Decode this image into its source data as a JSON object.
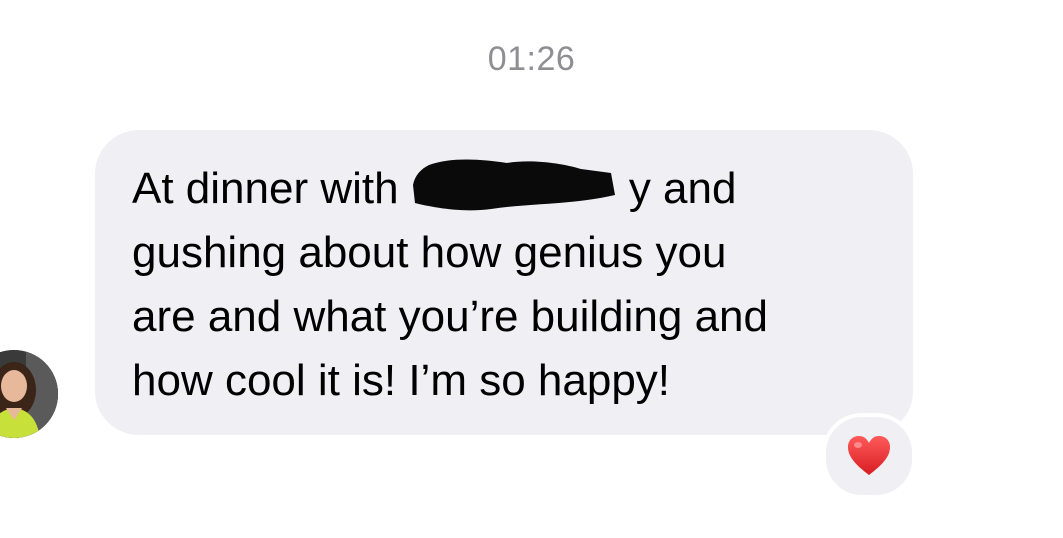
{
  "conversation": {
    "timestamp": "01:26"
  },
  "message": {
    "sender_avatar": "contact-avatar",
    "line1_before": "At dinner with ",
    "line1_after": "y and",
    "line2": "gushing about how genius you",
    "line3": "are and what you’re building and",
    "line4": "how cool it is! I’m so happy!",
    "redacted": true,
    "bubble_color": "#efeff4"
  },
  "reaction": {
    "icon": "red-heart-icon",
    "color": "#ef2b2d"
  }
}
